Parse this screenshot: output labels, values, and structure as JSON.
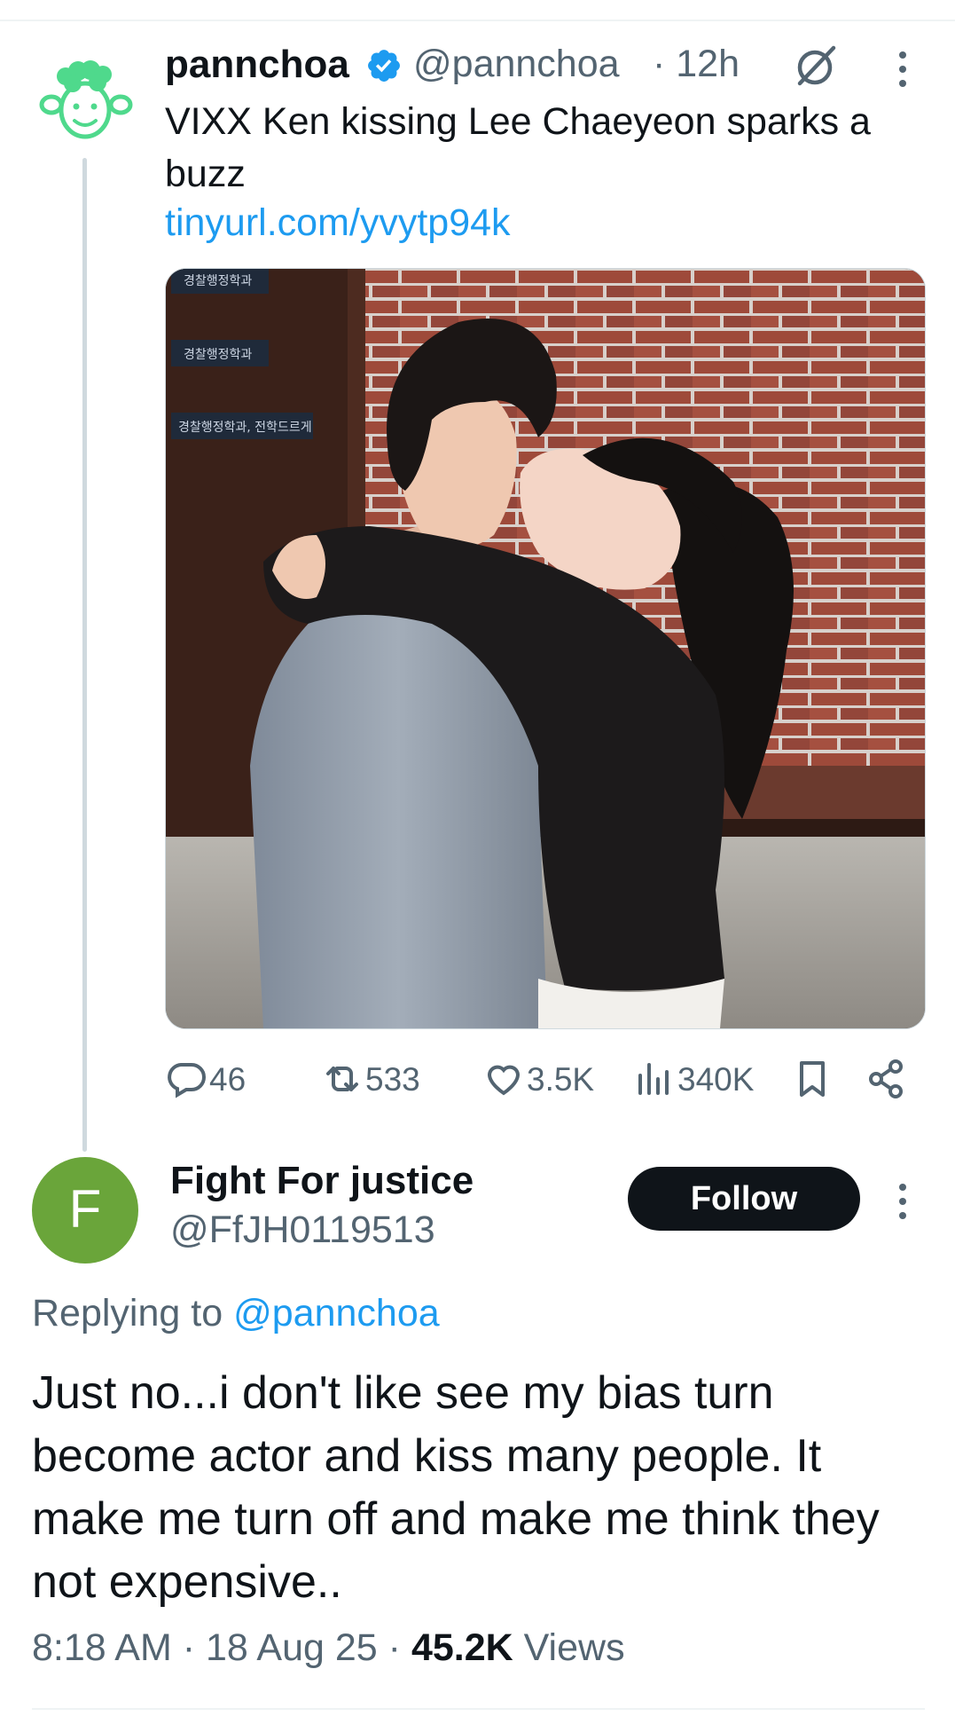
{
  "original_tweet": {
    "display_name": "pannchoa",
    "handle": "@pannchoa",
    "time": "· 12h",
    "text": "VIXX Ken kissing Lee Chaeyeon sparks a buzz",
    "link": "tinyurl.com/yvytp94k",
    "media_signs": [
      "경찰행정학과",
      "경찰행정학과",
      "경찰행정학과, 전학드르게"
    ],
    "stats": {
      "replies": "46",
      "reposts": "533",
      "likes": "3.5K",
      "views": "340K"
    }
  },
  "reply": {
    "avatar_letter": "F",
    "avatar_color": "#6aa53a",
    "display_name": "Fight For justice",
    "handle": "@FfJH0119513",
    "follow_label": "Follow",
    "replying_prefix": "Replying to",
    "replying_to": "@pannchoa",
    "text": "Just no...i don't like see my bias turn become actor and kiss many people. It make me turn off and make me think they not expensive..",
    "time": "8:18 AM",
    "date": "18 Aug 25",
    "separator": "·",
    "views_count": "45.2K",
    "views_label": "Views"
  },
  "colors": {
    "accent": "#1d9bf0",
    "secondary_text": "#536471",
    "primary_text": "#0f1419"
  }
}
